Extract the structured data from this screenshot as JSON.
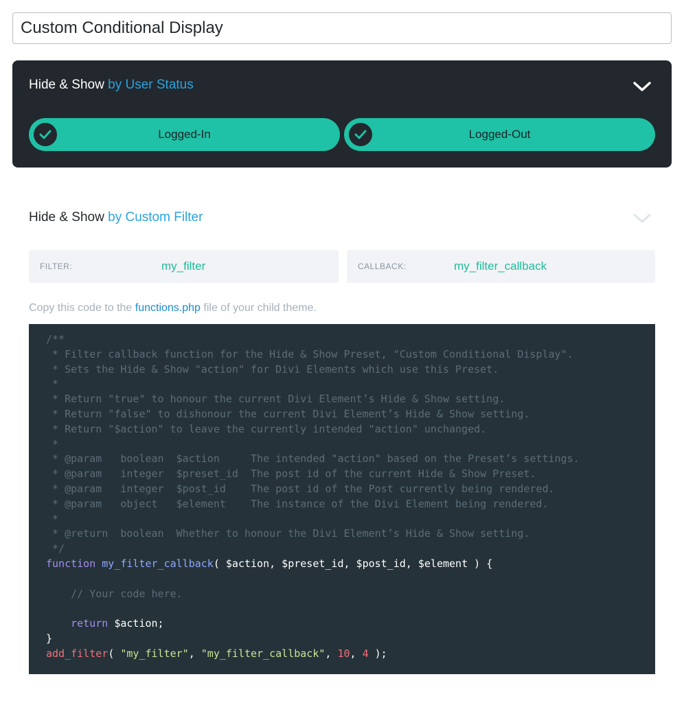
{
  "title_input": {
    "value": "Custom Conditional Display"
  },
  "user_status": {
    "heading_prefix": "Hide & Show",
    "heading_accent": "by User Status",
    "toggles": [
      {
        "label": "Logged-In",
        "checked": true
      },
      {
        "label": "Logged-Out",
        "checked": true
      }
    ]
  },
  "custom_filter": {
    "heading_prefix": "Hide & Show",
    "heading_accent": "by Custom Filter",
    "filter_label": "FILTER:",
    "filter_value": "my_filter",
    "callback_label": "CALLBACK:",
    "callback_value": "my_filter_callback",
    "hint_prefix": "Copy this code to the",
    "hint_link": "functions.php",
    "hint_suffix": "file of your child theme."
  },
  "code": {
    "comment_lines": [
      "/**",
      " * Filter callback function for the Hide & Show Preset, \"Custom Conditional Display\".",
      " * Sets the Hide & Show \"action\" for Divi Elements which use this Preset.",
      " *",
      " * Return \"true\" to honour the current Divi Element’s Hide & Show setting.",
      " * Return \"false\" to dishonour the current Divi Element’s Hide & Show setting.",
      " * Return \"$action\" to leave the currently intended \"action\" unchanged.",
      " *",
      " * @param   boolean  $action     The intended \"action\" based on the Preset’s settings.",
      " * @param   integer  $preset_id  The post id of the current Hide & Show Preset.",
      " * @param   integer  $post_id    The post id of the Post currently being rendered.",
      " * @param   object   $element    The instance of the Divi Element being rendered.",
      " *",
      " * @return  boolean  Whether to honour the Divi Element’s Hide & Show setting.",
      " */"
    ],
    "fn_keyword": "function",
    "fn_name": "my_filter_callback",
    "fn_params": "( $action, $preset_id, $post_id, $element ) {",
    "body_comment": "    // Your code here.",
    "return_keyword": "    return",
    "return_value": " $action;",
    "close_brace": "}",
    "add_filter_fn": "add_filter",
    "add_filter_open": "( ",
    "add_filter_arg1": "\"my_filter\"",
    "add_filter_sep1": ", ",
    "add_filter_arg2": "\"my_filter_callback\"",
    "add_filter_sep2": ", ",
    "add_filter_arg3": "10",
    "add_filter_sep3": ", ",
    "add_filter_arg4": "4",
    "add_filter_close": " );"
  },
  "colors": {
    "teal": "#1fc2a6",
    "accent_blue": "#2aa3e0",
    "dark_panel": "#22282d",
    "code_bg": "#253239"
  },
  "icons": [
    "chevron-down-icon",
    "check-icon"
  ]
}
